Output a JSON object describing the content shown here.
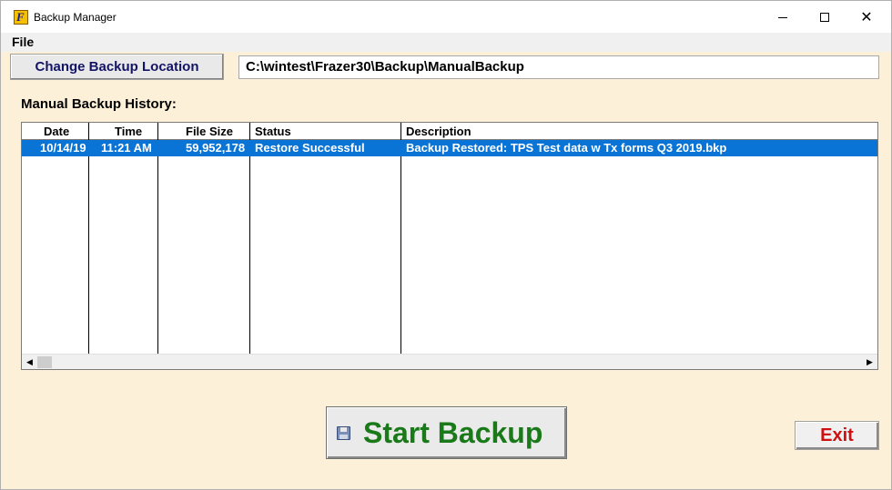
{
  "window": {
    "title": "Backup Manager",
    "app_icon_glyph": "F"
  },
  "window_controls": {
    "minimize": "minimize-icon",
    "maximize": "maximize-icon",
    "close": "close-icon",
    "close_glyph": "✕"
  },
  "menu": {
    "file_label": "File"
  },
  "toolbar": {
    "change_location_label": "Change Backup Location",
    "path_value": "C:\\wintest\\Frazer30\\Backup\\ManualBackup"
  },
  "history": {
    "label": "Manual Backup History:",
    "columns": [
      "Date",
      "Time",
      "File Size",
      "Status",
      "Description"
    ],
    "rows": [
      {
        "date": "10/14/19",
        "time": "11:21 AM",
        "file_size": "59,952,178",
        "status": "Restore Successful",
        "description": "Backup Restored: TPS Test data w Tx forms Q3 2019.bkp",
        "selected": true
      }
    ],
    "scroll_left_glyph": "◀",
    "scroll_right_glyph": "▶"
  },
  "actions": {
    "start_backup_label": "Start Backup",
    "exit_label": "Exit"
  },
  "colors": {
    "background": "#fdf0d8",
    "selection": "#0a74d6",
    "start_text": "#1a7a1a",
    "exit_text": "#d01010",
    "change_text": "#141466"
  }
}
